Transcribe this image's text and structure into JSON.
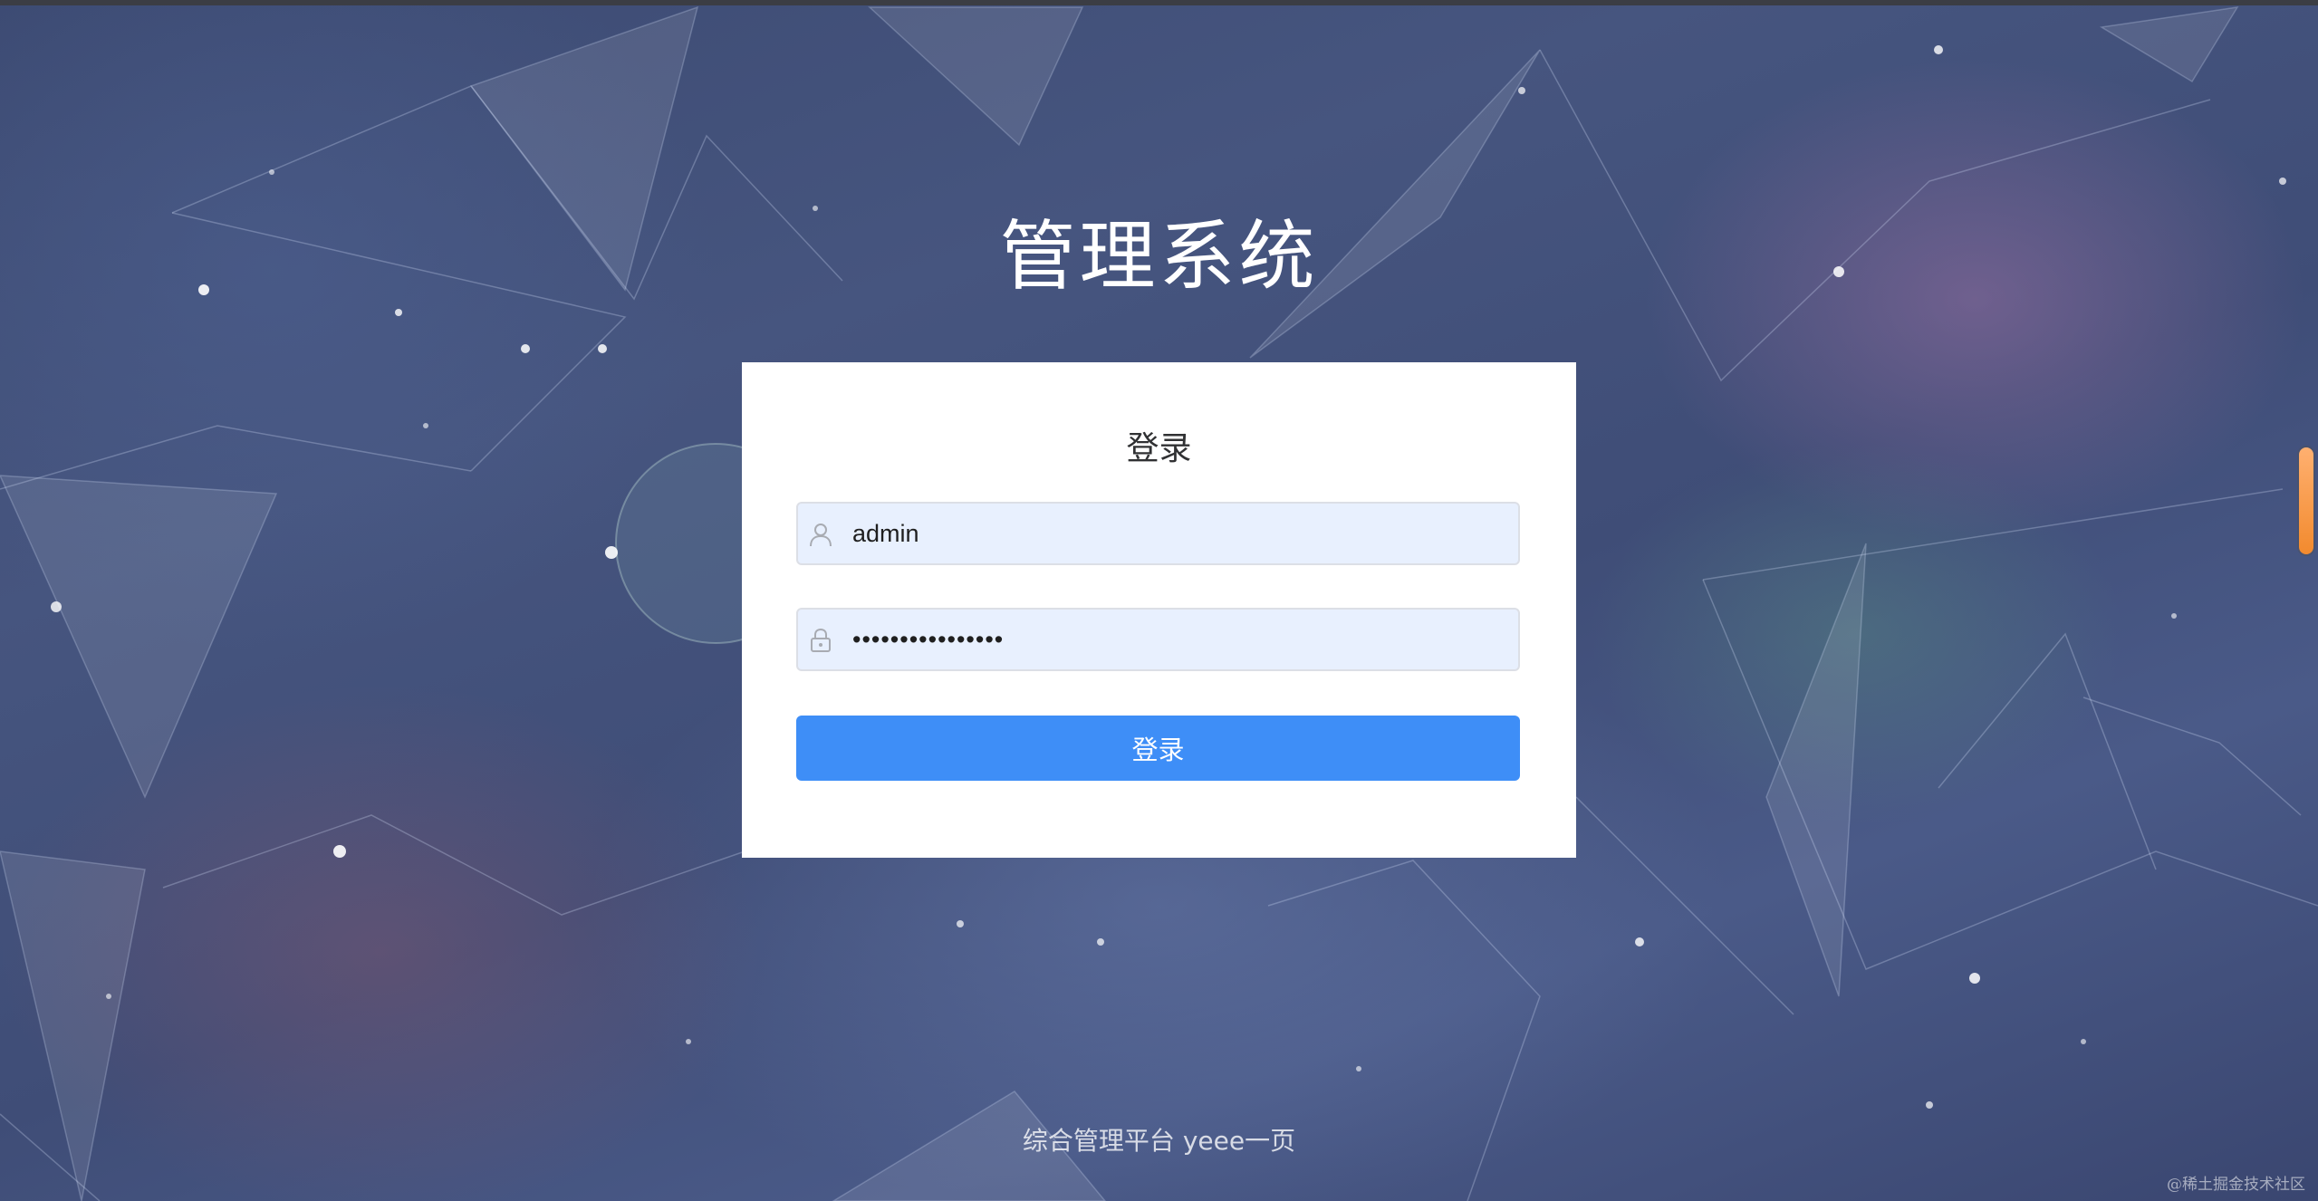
{
  "app": {
    "title": "管理系统"
  },
  "login": {
    "heading": "登录",
    "username": {
      "value": "admin",
      "icon": "user-icon"
    },
    "password": {
      "value": "••••••••••••••••",
      "icon": "lock-icon"
    },
    "submit_label": "登录"
  },
  "footer": {
    "text": "综合管理平台 yeee一页"
  },
  "watermark": {
    "text": "@稀土掘金技术社区"
  },
  "colors": {
    "accent": "#3e8ef7",
    "input_background": "#e8f0fe",
    "card_background": "#ffffff",
    "scroll_handle": "#f28a2e"
  }
}
